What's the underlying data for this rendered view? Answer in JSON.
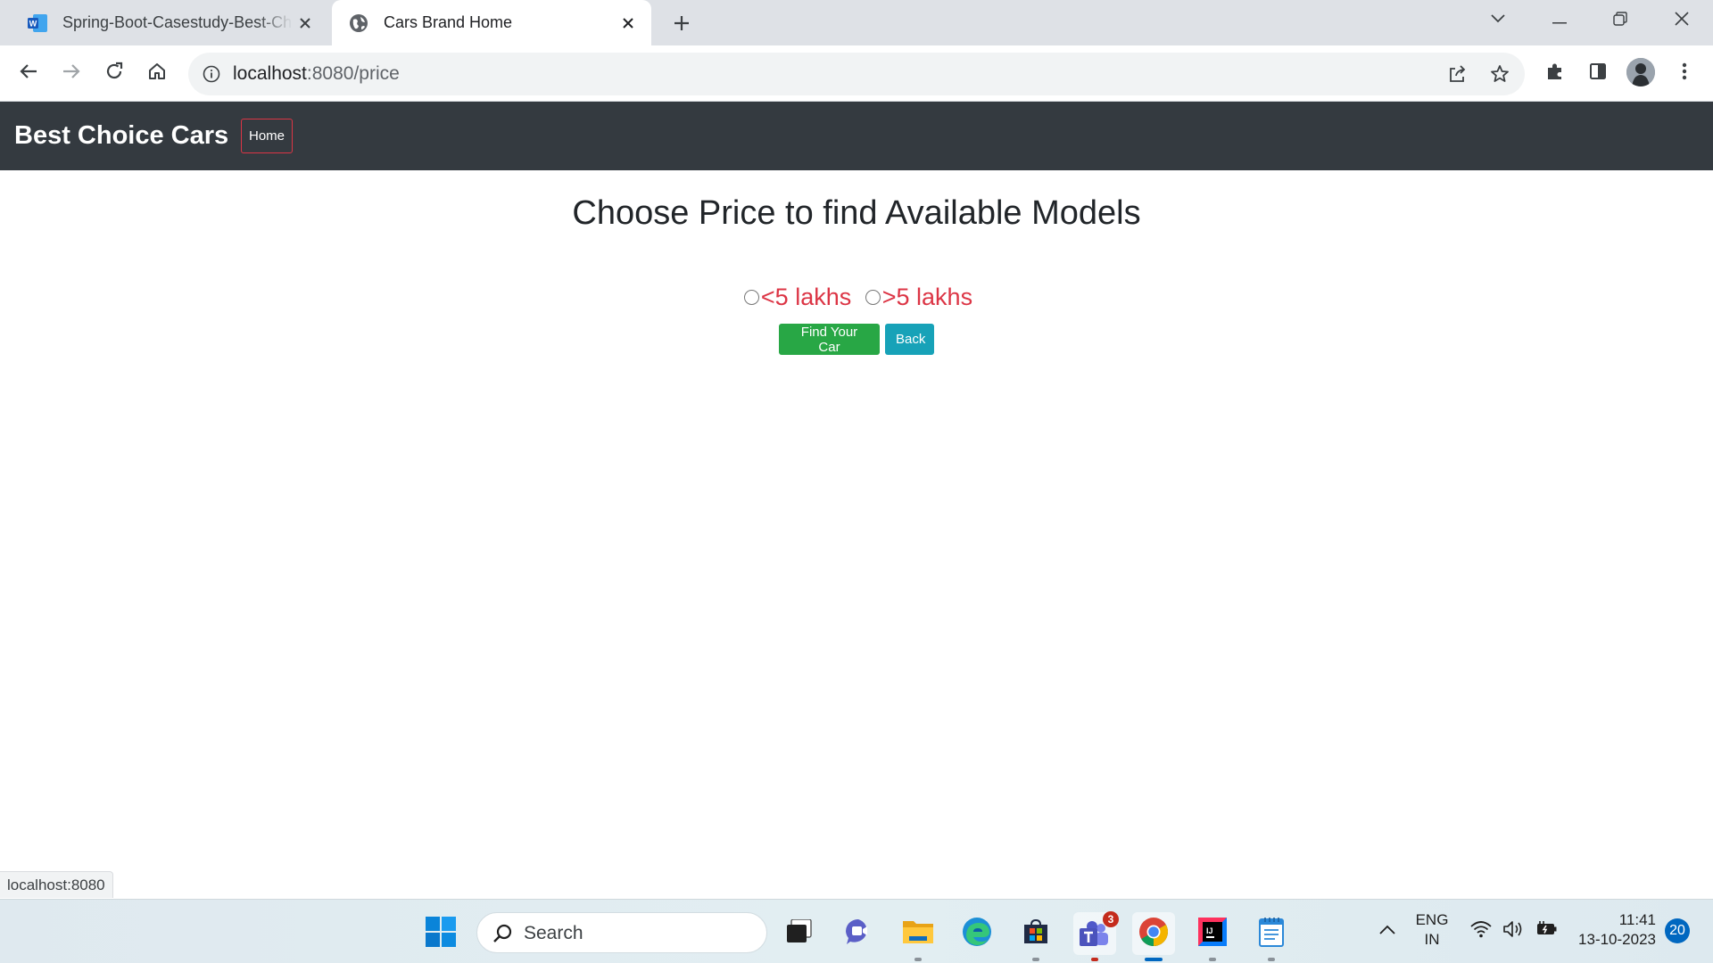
{
  "browser": {
    "tabs": [
      {
        "title": "Spring-Boot-Casestudy-Best-Ch",
        "icon": "word-icon",
        "active": false
      },
      {
        "title": "Cars Brand Home",
        "icon": "globe-icon",
        "active": true
      }
    ],
    "url_host": "localhost",
    "url_path": ":8080/price",
    "status_text": "localhost:8080"
  },
  "page": {
    "brand": "Best Choice Cars",
    "nav_home": "Home",
    "heading": "Choose Price to find Available Models",
    "options": [
      {
        "label": "<5 lakhs",
        "checked": false
      },
      {
        "label": ">5 lakhs",
        "checked": false
      }
    ],
    "find_button": "Find Your Car",
    "back_button": "Back",
    "colors": {
      "navbar": "#343a40",
      "option_text": "#dc3545",
      "find_button": "#28a745",
      "back_button": "#17a2b8",
      "home_border": "#dc3545"
    }
  },
  "taskbar": {
    "search_placeholder": "Search",
    "apps": [
      "start-icon",
      "task-view-icon",
      "teams-meet-icon",
      "file-explorer-icon",
      "edge-icon",
      "store-icon",
      "teams-icon",
      "chrome-icon",
      "intellij-icon",
      "notepad-icon"
    ],
    "teams_badge": "3",
    "lang_line1": "ENG",
    "lang_line2": "IN",
    "time": "11:41",
    "date": "13-10-2023",
    "notifications": "20"
  }
}
